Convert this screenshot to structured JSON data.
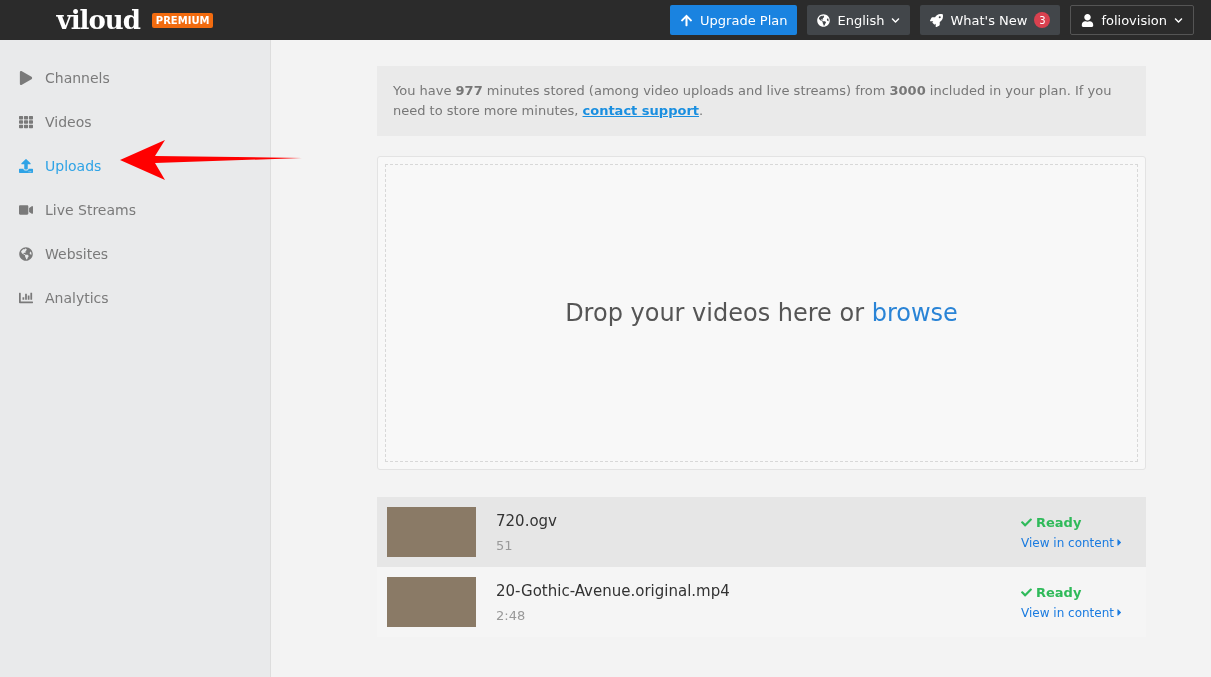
{
  "topbar": {
    "logo": "viloud",
    "badge": "PREMIUM",
    "buttons": [
      {
        "kind": "upgrade",
        "label": "Upgrade Plan"
      },
      {
        "kind": "language",
        "label": "English"
      },
      {
        "kind": "news",
        "label": "What's New",
        "count": "3"
      },
      {
        "kind": "user",
        "label": "foliovision"
      }
    ]
  },
  "sidebar": {
    "items": [
      {
        "kind": "play",
        "label": "Channels",
        "selected": false
      },
      {
        "kind": "grid",
        "label": "Videos",
        "selected": false
      },
      {
        "kind": "upload",
        "label": "Uploads",
        "selected": true
      },
      {
        "kind": "camera",
        "label": "Live Streams",
        "selected": false
      },
      {
        "kind": "globe",
        "label": "Websites",
        "selected": false
      },
      {
        "kind": "chart",
        "label": "Analytics",
        "selected": false
      }
    ]
  },
  "notice": {
    "text": "You have **977** minutes stored (among video uploads and live streams) from **3000** included in your plan. If you need to store more minutes, ",
    "link": "contact support",
    "end": "."
  },
  "dropzone": {
    "text": "Drop your videos here or ",
    "link": "browse"
  },
  "uploads": [
    {
      "name": "720.ogv",
      "duration": "51",
      "status": "Ready",
      "action": "View in content",
      "highlighted": true
    },
    {
      "name": "20-Gothic-Avenue.original.mp4",
      "duration": "2:48",
      "status": "Ready",
      "action": "View in content",
      "highlighted": false
    }
  ]
}
